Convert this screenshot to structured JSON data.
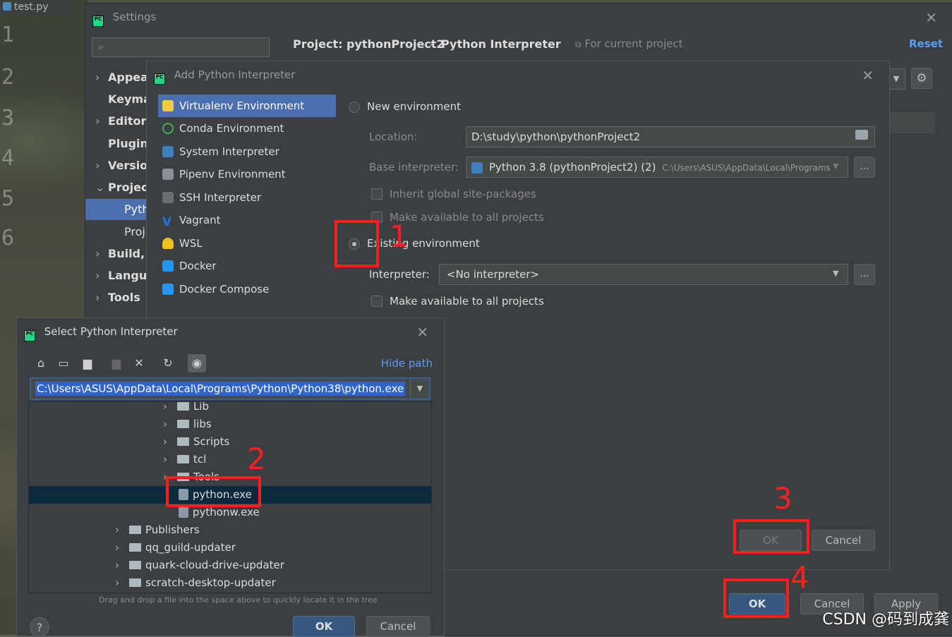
{
  "editor": {
    "tab": "test.py",
    "line_numbers": [
      "1",
      "2",
      "3",
      "4",
      "5",
      "6"
    ]
  },
  "settings": {
    "title": "Settings",
    "tree": [
      "Appear",
      "Keyma",
      "Editor",
      "Plugins",
      "Version",
      "Project",
      "Pyth",
      "Proje",
      "Build, E",
      "Langua",
      "Tools"
    ],
    "breadcrumb": [
      "Project: pythonProject2",
      "Python Interpreter"
    ],
    "breadcrumb_sep": "›",
    "for_current_project": "For current project",
    "reset": "Reset",
    "ok": "OK",
    "cancel": "Cancel",
    "apply": "Apply"
  },
  "add_dialog": {
    "title": "Add Python Interpreter",
    "env_types": [
      "Virtualenv Environment",
      "Conda Environment",
      "System Interpreter",
      "Pipenv Environment",
      "SSH Interpreter",
      "Vagrant",
      "WSL",
      "Docker",
      "Docker Compose"
    ],
    "new_env": "New environment",
    "location_label": "Location:",
    "location_value": "D:\\study\\python\\pythonProject2",
    "base_label": "Base interpreter:",
    "base_value": "Python 3.8 (pythonProject2) (2)",
    "base_path": "C:\\Users\\ASUS\\AppData\\Local\\Programs",
    "inherit": "Inherit global site-packages",
    "make_available_1": "Make available to all projects",
    "existing_env": "Existing environment",
    "interpreter_label": "Interpreter:",
    "interpreter_value": "<No interpreter>",
    "make_available_2": "Make available to all projects",
    "browse": "...",
    "ok": "OK",
    "cancel": "Cancel"
  },
  "select_dialog": {
    "title": "Select Python Interpreter",
    "hide_path": "Hide path",
    "path": "C:\\Users\\ASUS\\AppData\\Local\\Programs\\Python\\Python38\\python.exe",
    "tree": {
      "lib": "Lib",
      "libs": "libs",
      "scripts": "Scripts",
      "tcl": "tcl",
      "tools": "Tools",
      "python_exe": "python.exe",
      "pythonw_exe": "pythonw.exe",
      "publishers": "Publishers",
      "qq": "qq_guild-updater",
      "quark": "quark-cloud-drive-updater",
      "scratch": "scratch-desktop-updater"
    },
    "hint": "Drag and drop a file into the space above to quickly locate it in the tree",
    "help": "?",
    "ok": "OK",
    "cancel": "Cancel"
  },
  "annotations": [
    "1",
    "2",
    "3",
    "4"
  ],
  "watermark": "CSDN @码到成龚",
  "colors": {
    "accent": "#4b6eaf",
    "primary_button": "#365880",
    "annotation": "#ff1e1e",
    "link": "#589df6"
  }
}
